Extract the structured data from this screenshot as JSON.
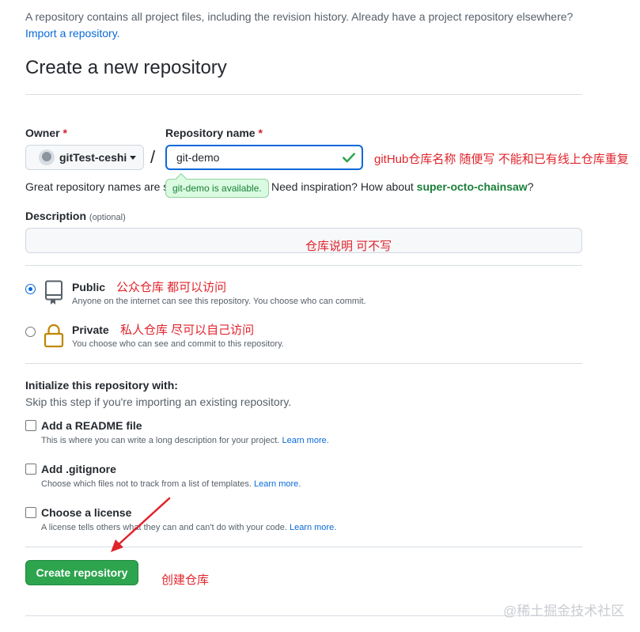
{
  "intro": {
    "text": "A repository contains all project files, including the revision history. Already have a project repository elsewhere?",
    "import_link": "Import a repository."
  },
  "page_title": "Create a new repository",
  "owner": {
    "label": "Owner",
    "required_mark": "*",
    "value": "gitTest-ceshi"
  },
  "repo_name": {
    "label": "Repository name",
    "required_mark": "*",
    "value": "git-demo",
    "available_tooltip": "git-demo is available."
  },
  "separator": "/",
  "name_hint": {
    "prefix": "Great repository names are s",
    "middle": "Need inspiration? How about ",
    "suggestion": "super-octo-chainsaw",
    "suffix": "?"
  },
  "description": {
    "label": "Description",
    "optional": "(optional)",
    "value": ""
  },
  "visibility": {
    "public": {
      "title": "Public",
      "desc": "Anyone on the internet can see this repository. You choose who can commit.",
      "checked": true
    },
    "private": {
      "title": "Private",
      "desc": "You choose who can see and commit to this repository.",
      "checked": false
    }
  },
  "init": {
    "title": "Initialize this repository with:",
    "subtitle": "Skip this step if you're importing an existing repository.",
    "learn_more": "Learn more.",
    "readme": {
      "title": "Add a README file",
      "desc": "This is where you can write a long description for your project.",
      "checked": false
    },
    "gitignore": {
      "title": "Add .gitignore",
      "desc": "Choose which files not to track from a list of templates.",
      "checked": false
    },
    "license": {
      "title": "Choose a license",
      "desc": "A license tells others what they can and can't do with your code.",
      "checked": false
    }
  },
  "create_button": "Create repository",
  "annotations": {
    "repo_name": "gitHub仓库名称 随便写 不能和已有线上仓库重复",
    "description": "仓库说明 可不写",
    "public": "公众仓库 都可以访问",
    "private": "私人仓库 尽可以自己访问",
    "create": "创建仓库"
  },
  "watermark": "@稀土掘金技术社区",
  "colors": {
    "accent_blue": "#0969da",
    "success_green": "#2da44e",
    "annotation_red": "#e0242c"
  },
  "icons": {
    "public": "repo-book-icon",
    "private": "lock-icon",
    "available": "check-icon"
  }
}
